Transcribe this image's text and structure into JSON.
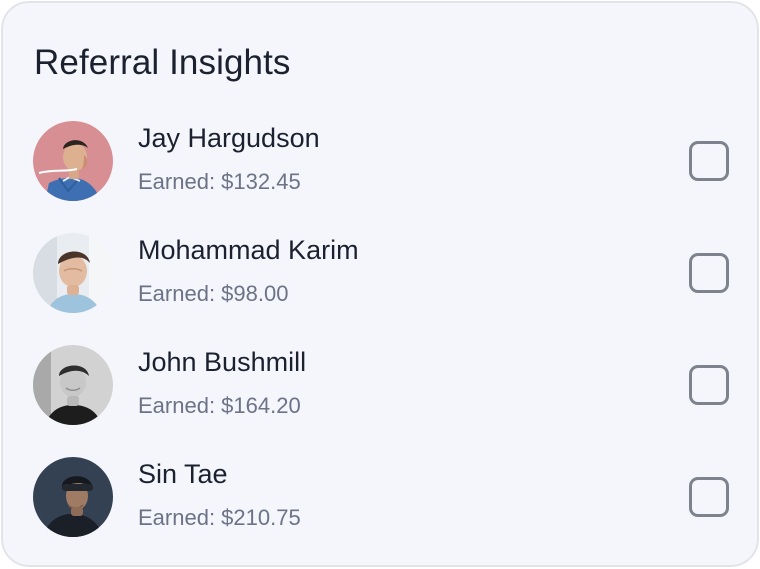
{
  "card": {
    "title": "Referral Insights"
  },
  "referrals": [
    {
      "name": "Jay Hargudson",
      "earned": "Earned: $132.45",
      "checked": false
    },
    {
      "name": "Mohammad Karim",
      "earned": "Earned: $98.00",
      "checked": false
    },
    {
      "name": "John Bushmill",
      "earned": "Earned: $164.20",
      "checked": false
    },
    {
      "name": "Sin Tae",
      "earned": "Earned: $210.75",
      "checked": false
    }
  ],
  "colors": {
    "card_background": "#f5f6fb",
    "card_border": "#e2e4ea",
    "primary_text": "#1c2130",
    "secondary_text": "#6c7387",
    "checkbox_border": "#7d828c"
  }
}
